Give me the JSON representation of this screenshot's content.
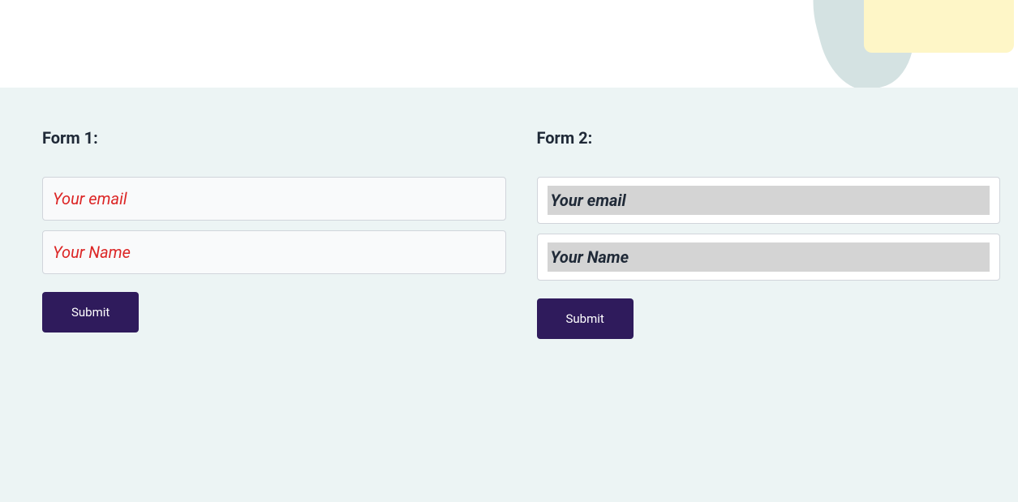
{
  "form1": {
    "title": "Form 1:",
    "email_placeholder": "Your email",
    "name_placeholder": "Your Name",
    "submit_label": "Submit"
  },
  "form2": {
    "title": "Form 2:",
    "email_placeholder": "Your email",
    "name_placeholder": "Your Name",
    "submit_label": "Submit"
  },
  "colors": {
    "accent": "#2f1b5c",
    "placeholder_error": "#dc2626",
    "panel_bg": "#ecf4f4",
    "input_gray_bg": "#d4d4d4"
  }
}
